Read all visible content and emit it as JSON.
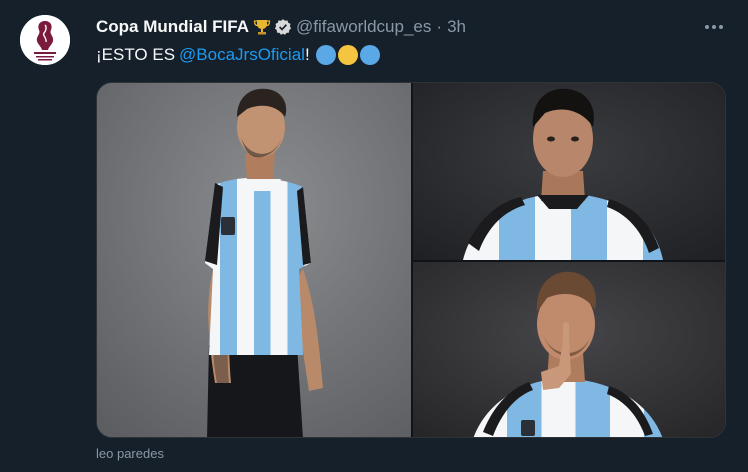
{
  "tweet": {
    "display_name": "Copa Mundial FIFA",
    "handle": "@fifaworldcup_es",
    "separator": "·",
    "time": "3h",
    "text_prefix": "¡ESTO ES",
    "mention": "@BocaJrsOficial",
    "text_suffix": "!",
    "emojis": [
      "#5aa9e6",
      "#f5c542",
      "#5aa9e6"
    ],
    "avatar_text": "FIFA WORLD CUP Qatar 2022",
    "icons": [
      "trophy-icon",
      "verified-badge-icon",
      "more-options-icon"
    ]
  },
  "media": {
    "photos": [
      {
        "name": "photo-player-left"
      },
      {
        "name": "photo-player-top-right"
      },
      {
        "name": "photo-player-bottom-right"
      }
    ],
    "caption": "leo paredes"
  },
  "colors": {
    "background": "#15202b",
    "text": "#f7f9f9",
    "secondary": "#8b98a5",
    "link": "#1d9bf0",
    "verified": "#d9d9d9",
    "jersey_blue": "#7fb8e3"
  }
}
